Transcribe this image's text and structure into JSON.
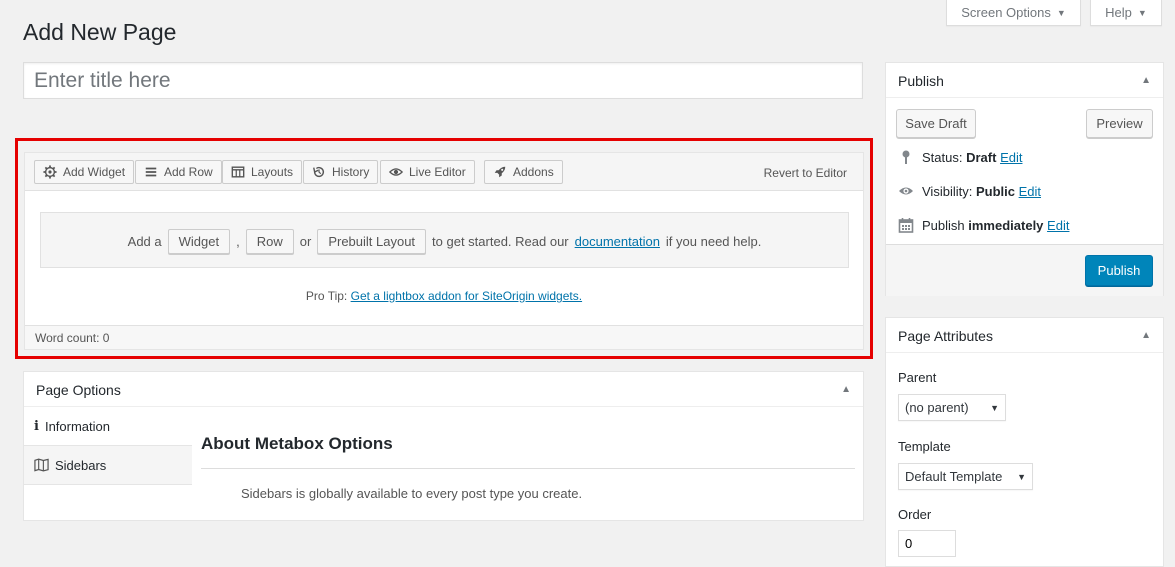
{
  "header": {
    "page_title": "Add New Page",
    "screen_options_label": "Screen Options",
    "help_label": "Help"
  },
  "title_field": {
    "placeholder": "Enter title here",
    "value": ""
  },
  "builder": {
    "toolbar": {
      "add_widget": "Add Widget",
      "add_row": "Add Row",
      "layouts": "Layouts",
      "history": "History",
      "live_editor": "Live Editor",
      "addons": "Addons",
      "revert": "Revert to Editor"
    },
    "welcome": {
      "prefix": "Add a",
      "widget": "Widget",
      "comma": ",",
      "row": "Row",
      "or": "or",
      "prebuilt": "Prebuilt Layout",
      "suffix_1": "to get started. Read our",
      "docs_link": "documentation",
      "suffix_2": "if you need help."
    },
    "protip": {
      "label": "Pro Tip:",
      "link": "Get a lightbox addon for SiteOrigin widgets."
    },
    "word_count": "Word count: 0"
  },
  "page_options": {
    "title": "Page Options",
    "tabs": [
      {
        "label": "Information",
        "icon": "info-icon"
      },
      {
        "label": "Sidebars",
        "icon": "map-icon"
      }
    ],
    "content_title": "About Metabox Options",
    "content_desc": "Sidebars is globally available to every post type you create."
  },
  "publish": {
    "title": "Publish",
    "save_draft": "Save Draft",
    "preview": "Preview",
    "status_label": "Status:",
    "status_value": "Draft",
    "visibility_label": "Visibility:",
    "visibility_value": "Public",
    "publish_label": "Publish",
    "publish_value": "immediately",
    "edit_label": "Edit",
    "publish_button": "Publish"
  },
  "page_attributes": {
    "title": "Page Attributes",
    "parent_label": "Parent",
    "parent_value": "(no parent)",
    "template_label": "Template",
    "template_value": "Default Template",
    "order_label": "Order",
    "order_value": "0"
  },
  "colors": {
    "accent": "#0085ba",
    "link": "#0073aa",
    "highlight": "#e50000"
  }
}
